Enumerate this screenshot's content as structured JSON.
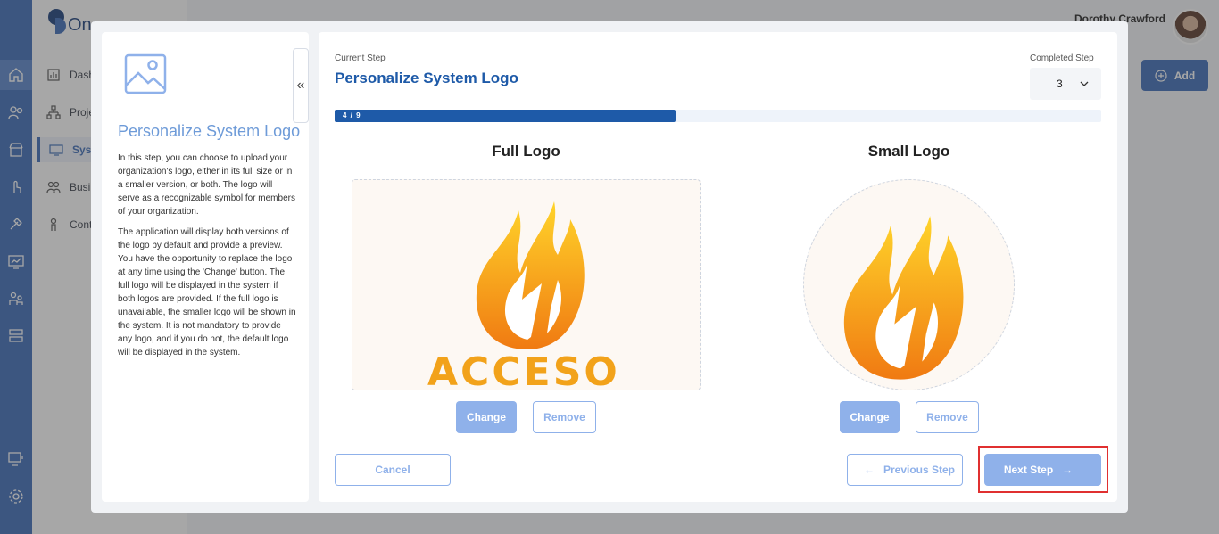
{
  "app": {
    "logo_text": "One"
  },
  "sidebar": {
    "items": [
      {
        "label": "Dash",
        "icon": "dashboard-icon"
      },
      {
        "label": "Proje",
        "icon": "hierarchy-icon"
      },
      {
        "label": "Syste",
        "icon": "system-icon",
        "active": true
      },
      {
        "label": "Busi",
        "icon": "users-icon"
      },
      {
        "label": "Cont",
        "icon": "contact-icon"
      }
    ]
  },
  "rail": {
    "icons": [
      "home-icon",
      "people-icon",
      "store-icon",
      "touch-icon",
      "tools-icon",
      "monitor-chart-icon",
      "team-icon",
      "server-icon",
      "display-settings-icon",
      "gear-icon"
    ]
  },
  "header": {
    "user_name": "Dorothy Crawford",
    "add_label": "Add"
  },
  "modal": {
    "info": {
      "title": "Personalize System Logo",
      "paragraph1": "In this step, you can choose to upload your organization's logo, either in its full size or in a smaller version, or both. The logo will serve as a recognizable symbol for members of your organization.",
      "paragraph2": "The application will display both versions of the logo by default and provide a preview. You have the opportunity to replace the logo at any time using the 'Change' button. The full logo will be displayed in the system if both logos are provided. If the full logo is unavailable, the smaller logo will be shown in the system. It is not mandatory to provide any logo, and if you do not, the default logo will be displayed in the system."
    },
    "current_step_label": "Current Step",
    "current_step_title": "Personalize System Logo",
    "completed_step_label": "Completed Step",
    "completed_step_value": "3",
    "progress": {
      "text": "4 / 9",
      "current": 4,
      "total": 9
    },
    "full_logo": {
      "title": "Full Logo",
      "brand_text": "ACCESO",
      "change_label": "Change",
      "remove_label": "Remove"
    },
    "small_logo": {
      "title": "Small Logo",
      "change_label": "Change",
      "remove_label": "Remove"
    },
    "footer": {
      "cancel_label": "Cancel",
      "previous_label": "Previous Step",
      "next_label": "Next Step"
    }
  },
  "colors": {
    "primary": "#1e5aa8",
    "accent_light": "#8fb1ea",
    "rail": "#3d6cb8",
    "highlight": "#e03030"
  }
}
